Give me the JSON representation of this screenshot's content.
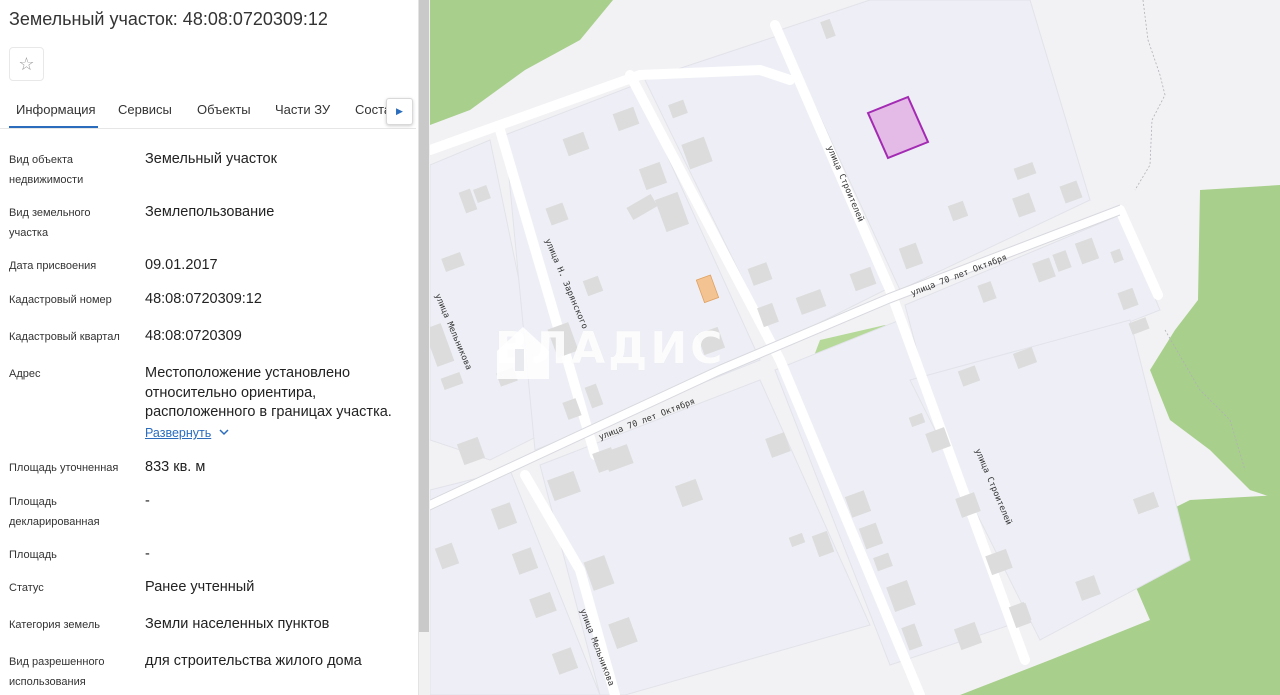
{
  "panel": {
    "title": "Земельный участок: 48:08:0720309:12",
    "favorite_icon": "star-icon",
    "tabs": [
      {
        "label": "Информация",
        "active": true
      },
      {
        "label": "Сервисы",
        "active": false
      },
      {
        "label": "Объекты",
        "active": false
      },
      {
        "label": "Части ЗУ",
        "active": false
      },
      {
        "label": "Соста",
        "active": false
      }
    ],
    "tabs_scroll_icon": "chevron-right-icon",
    "fields": [
      {
        "label_lines": [
          "Вид объекта",
          "недвижимости"
        ],
        "value": "Земельный участок"
      },
      {
        "label_lines": [
          "Вид земельного",
          "участка"
        ],
        "value": "Землепользование"
      },
      {
        "label_lines": [
          "Дата присвоения"
        ],
        "value": "09.01.2017"
      },
      {
        "label_lines": [
          "Кадастровый номер"
        ],
        "value": "48:08:0720309:12"
      },
      {
        "label_lines": [
          "Кадастровый квартал"
        ],
        "value": "48:08:0720309"
      },
      {
        "label_lines": [
          "Адрес"
        ],
        "value": "Местоположение установлено относительно ориентира, расположенного в границах участка."
      },
      {
        "label_lines": [
          "Площадь уточненная"
        ],
        "value": "833 кв. м"
      },
      {
        "label_lines": [
          "Площадь",
          "декларированная"
        ],
        "value": "-"
      },
      {
        "label_lines": [
          "Площадь"
        ],
        "value": "-"
      },
      {
        "label_lines": [
          "Статус"
        ],
        "value": "Ранее учтенный"
      },
      {
        "label_lines": [
          "Категория земель"
        ],
        "value": "Земли населенных пунктов"
      },
      {
        "label_lines": [
          "Вид разрешенного",
          "использования"
        ],
        "value": "для строительства жилого дома"
      }
    ],
    "expand_label": "Развернуть",
    "expand_icon": "chevron-down-icon"
  },
  "map": {
    "streets": [
      "улица Строителей",
      "улица 70 лет Октября",
      "улица 70 лет Октября",
      "улица Н. Зарянского",
      "улица Мельникова",
      "улица Мельникова",
      "улица Строителей"
    ],
    "watermark": "ВЛАДИС",
    "watermark_icon": "house-logo-icon",
    "colors": {
      "background": "#f2f2f4",
      "block": "#eeeff6",
      "road": "#ffffff",
      "building": "#dcdcdc",
      "forest": "#a8cf8c",
      "parcel_fill": "#e4b8e6",
      "parcel_stroke": "#a020b0",
      "selected_building": "#f3c392"
    }
  }
}
